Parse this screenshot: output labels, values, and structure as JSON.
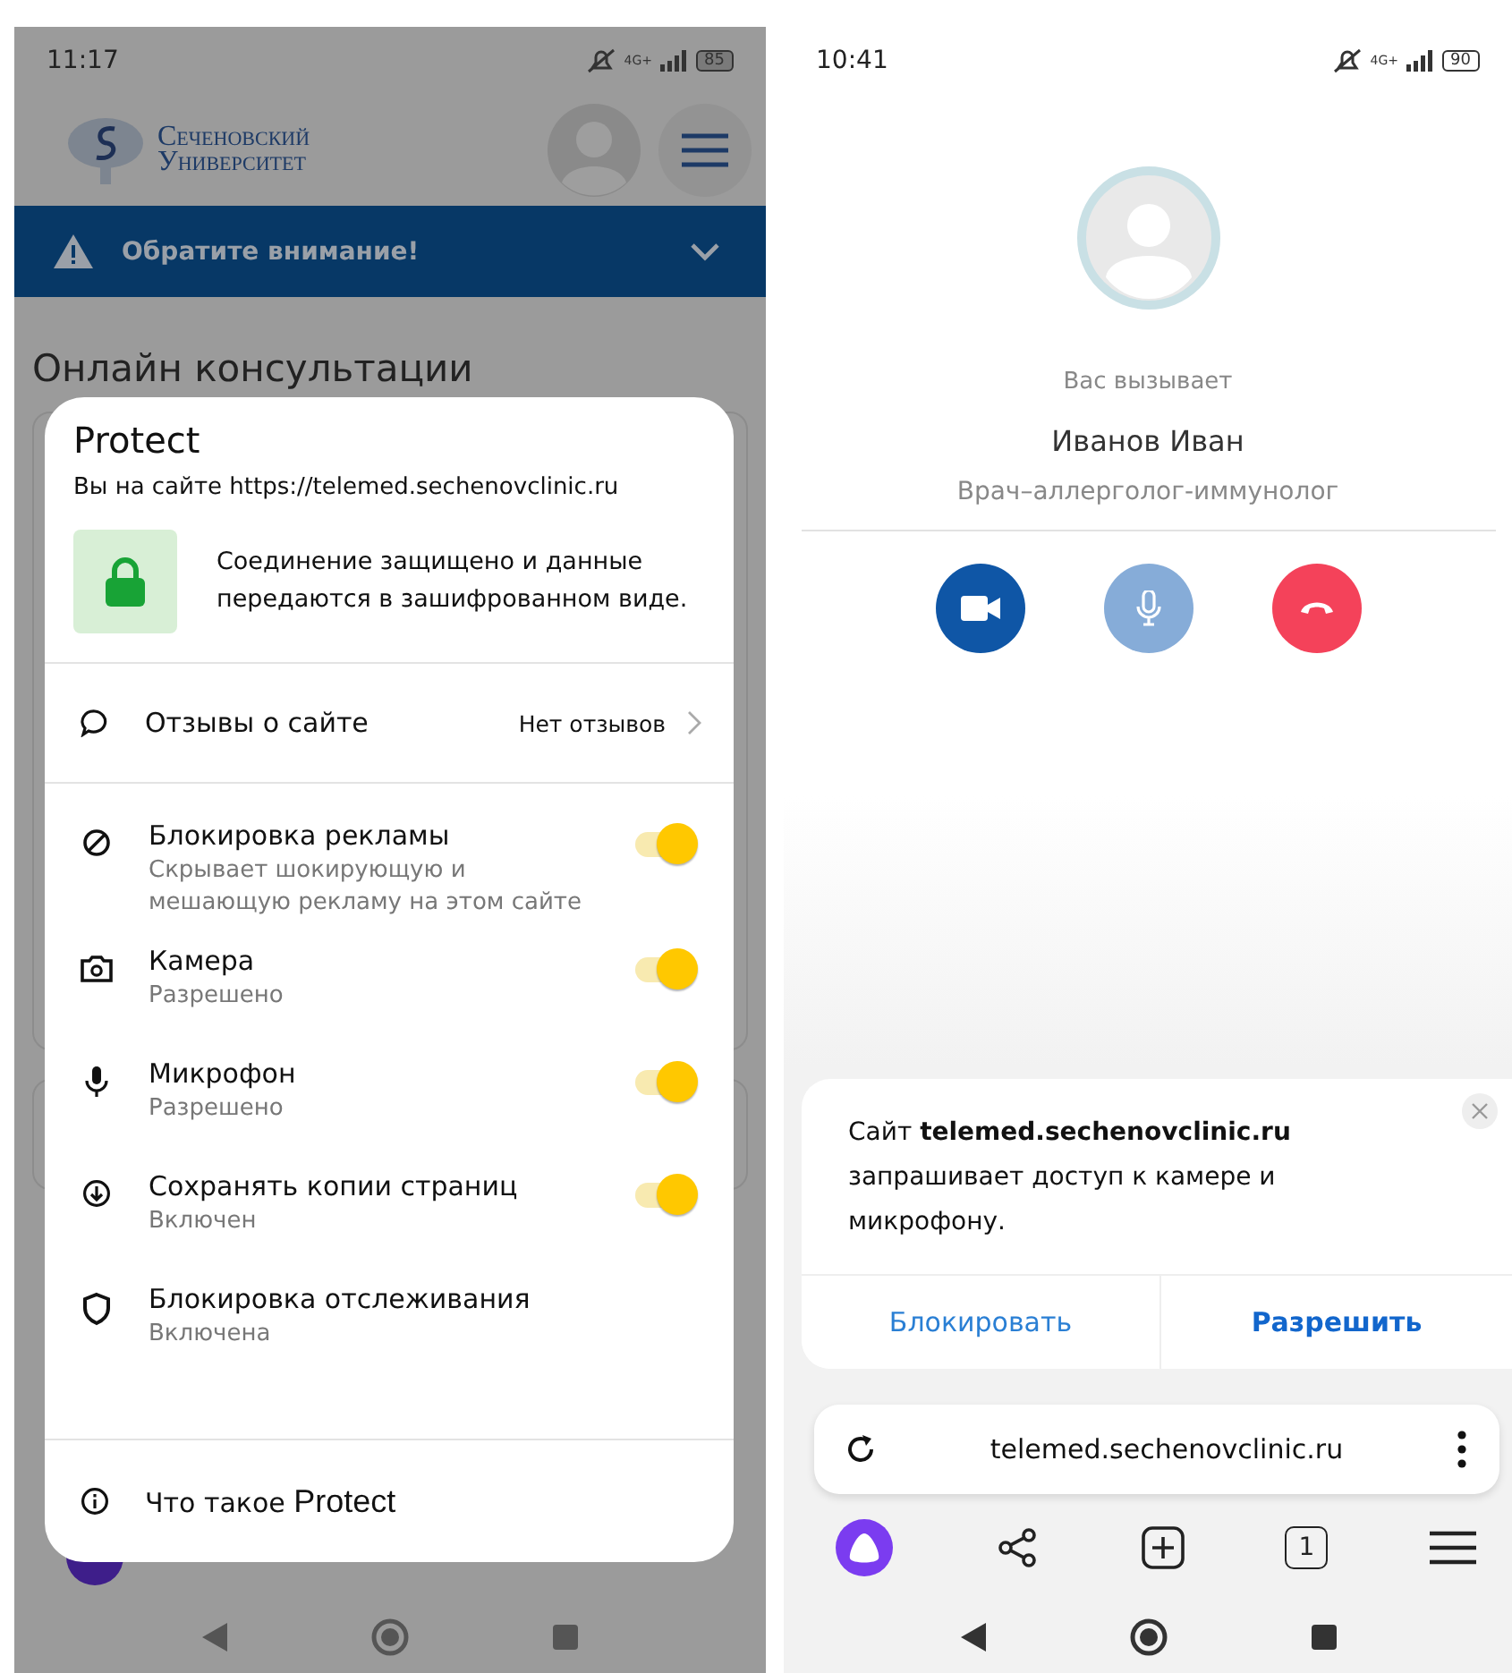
{
  "left_screen": {
    "status_bar": {
      "time": "11:17",
      "network": "4G+",
      "battery": "85"
    },
    "header": {
      "logo_lines": [
        "Сеченовский",
        "Университет"
      ]
    },
    "notice_banner": {
      "text": "Обратите внимание!"
    },
    "page_heading": "Онлайн консультации",
    "protect_sheet": {
      "title": "Protect",
      "site_text": "Вы на сайте https://telemed.sechenovclinic.ru",
      "security_text": "Соединение защищено и данные передаются в зашифрованном виде.",
      "reviews": {
        "label": "Отзывы о сайте",
        "value": "Нет отзывов"
      },
      "settings": [
        {
          "kind": "toggle",
          "label": "Блокировка рекламы",
          "description": "Скрывает шокирующую и мешающую рекламу на этом сайте",
          "on": true
        },
        {
          "kind": "toggle",
          "label": "Камера",
          "description": "Разрешено",
          "on": true
        },
        {
          "kind": "toggle",
          "label": "Микрофон",
          "description": "Разрешено",
          "on": true
        },
        {
          "kind": "toggle",
          "label": "Сохранять копии страниц",
          "description": "Включен",
          "on": true
        },
        {
          "kind": "info",
          "label": "Блокировка отслеживания",
          "description": "Включена"
        }
      ],
      "footer_link": {
        "prefix": "Что такое",
        "name": "Protect"
      }
    }
  },
  "right_screen": {
    "status_bar": {
      "time": "10:41",
      "network": "4G+",
      "battery": "90"
    },
    "incoming_call": {
      "caption": "Вас вызывает",
      "caller_name": "Иванов Иван",
      "caller_role": "Врач–аллерголог-иммунолог"
    },
    "permission_prompt": {
      "text": "Сайт **telemed.sechenovclinic.ru** запрашивает доступ к камере и микрофону.",
      "buttons": [
        {
          "label": "Блокировать",
          "primary": false
        },
        {
          "label": "Разрешить",
          "primary": true
        }
      ]
    },
    "address_bar": {
      "url": "telemed.sechenovclinic.ru"
    },
    "toolbar": {
      "tab_count": "1"
    }
  }
}
